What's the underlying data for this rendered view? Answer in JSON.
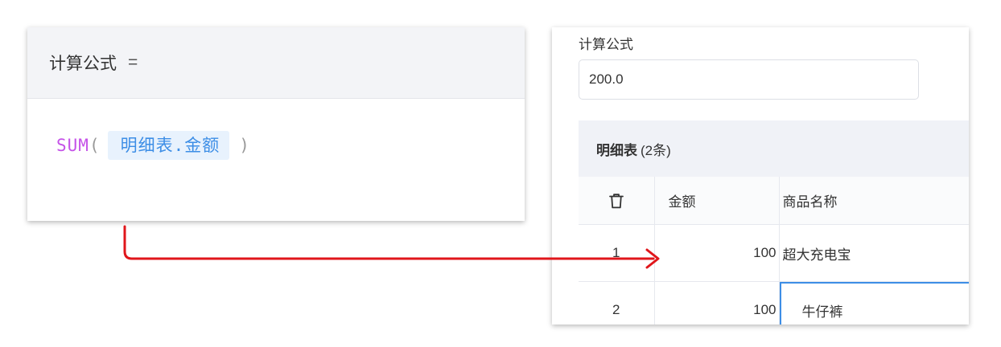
{
  "formula_editor": {
    "field_name": "计算公式",
    "equals_sign": "=",
    "function_name": "SUM",
    "open_paren": "(",
    "field_reference": "明细表.金额",
    "close_paren": ")"
  },
  "form": {
    "field_label": "计算公式",
    "field_value": "200.0",
    "subtable": {
      "title": "明细表",
      "count_text": "(2条)",
      "columns": [
        "",
        "金额",
        "商品名称"
      ],
      "rows": [
        {
          "index": "1",
          "amount": "100",
          "product": "超大充电宝"
        },
        {
          "index": "2",
          "amount": "100",
          "product": "牛仔裤"
        }
      ]
    }
  },
  "colors": {
    "arrow": "#e0161b",
    "function": "#c552e8",
    "field_chip_text": "#3d8ee6",
    "field_chip_bg": "#e8f2fd",
    "active_cell_border": "#3d8ee6"
  },
  "icons": {
    "delete_column": "trash-icon",
    "connector": "red-elbow-arrow"
  }
}
